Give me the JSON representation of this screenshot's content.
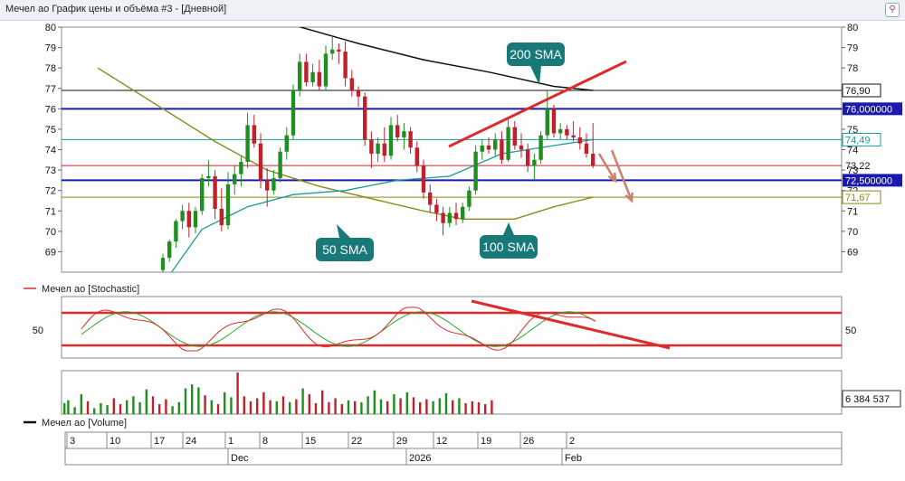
{
  "window": {
    "title": "Мечел ао График цены и объёма #3 - [Дневной]"
  },
  "colors": {
    "up": "#1f8f1f",
    "down": "#c0202a",
    "sma50": "#1a9a9a",
    "sma100": "#8a8a1a",
    "sma200": "#111111",
    "support": "#1a1ab0",
    "trend": "#dd2b2b",
    "arrow": "#c8826a",
    "callout": "#197878"
  },
  "price_panel": {
    "levels": [
      {
        "value": 76.9,
        "label": "76,90",
        "color": "#111111",
        "boxed": true
      },
      {
        "value": 76.0,
        "label": "76,000000",
        "color": "#1a1ab0",
        "highlight": true
      },
      {
        "value": 74.49,
        "label": "74,49",
        "color": "#1a9a9a",
        "boxed": true
      },
      {
        "value": 73.22,
        "label": "73,22",
        "color": "#c0202a",
        "boxed": false
      },
      {
        "value": 72.5,
        "label": "72,500000",
        "color": "#1a1ab0",
        "highlight": true
      },
      {
        "value": 71.67,
        "label": "71,67",
        "color": "#8a8a1a",
        "boxed": true
      }
    ],
    "callouts": [
      "200 SMA",
      "50 SMA",
      "100 SMA"
    ]
  },
  "stochastic_panel": {
    "legend": "Мечел ао [Stochastic]",
    "tick": "50"
  },
  "volume_panel": {
    "legend": "Мечел ао [Volume]",
    "last_value": "6 384 537"
  },
  "time_axis": {
    "day_labels": [
      "3",
      "10",
      "17",
      "24",
      "1",
      "8",
      "15",
      "22",
      "29",
      "12",
      "19",
      "26",
      "2"
    ],
    "month_labels": [
      "Dec",
      "2026",
      "Feb"
    ]
  },
  "chart_data": {
    "type": "candlestick",
    "ylim": [
      68,
      80
    ],
    "yticks": [
      69,
      70,
      71,
      72,
      73,
      74,
      75,
      76,
      77,
      78,
      79,
      80
    ],
    "candles": [
      {
        "o": 68.1,
        "h": 68.9,
        "l": 67.9,
        "c": 68.7
      },
      {
        "o": 68.7,
        "h": 69.6,
        "l": 68.5,
        "c": 69.5
      },
      {
        "o": 69.5,
        "h": 70.6,
        "l": 69.2,
        "c": 70.5
      },
      {
        "o": 70.5,
        "h": 71.3,
        "l": 70.1,
        "c": 71.0
      },
      {
        "o": 71.0,
        "h": 71.4,
        "l": 69.7,
        "c": 70.2
      },
      {
        "o": 70.2,
        "h": 71.2,
        "l": 69.9,
        "c": 71.0
      },
      {
        "o": 71.0,
        "h": 72.8,
        "l": 70.8,
        "c": 72.6
      },
      {
        "o": 72.6,
        "h": 73.5,
        "l": 72.2,
        "c": 72.7
      },
      {
        "o": 72.7,
        "h": 73.0,
        "l": 70.6,
        "c": 71.1
      },
      {
        "o": 71.1,
        "h": 72.1,
        "l": 70.0,
        "c": 70.3
      },
      {
        "o": 70.3,
        "h": 72.9,
        "l": 70.1,
        "c": 72.3
      },
      {
        "o": 72.3,
        "h": 73.2,
        "l": 71.8,
        "c": 72.8
      },
      {
        "o": 72.8,
        "h": 73.7,
        "l": 72.2,
        "c": 73.4
      },
      {
        "o": 73.4,
        "h": 75.8,
        "l": 73.1,
        "c": 75.2
      },
      {
        "o": 75.2,
        "h": 75.7,
        "l": 74.1,
        "c": 74.3
      },
      {
        "o": 74.3,
        "h": 74.8,
        "l": 72.1,
        "c": 72.5
      },
      {
        "o": 72.5,
        "h": 73.1,
        "l": 71.2,
        "c": 72.0
      },
      {
        "o": 72.0,
        "h": 73.0,
        "l": 71.8,
        "c": 72.6
      },
      {
        "o": 72.6,
        "h": 74.1,
        "l": 72.4,
        "c": 73.9
      },
      {
        "o": 73.9,
        "h": 75.1,
        "l": 73.5,
        "c": 74.7
      },
      {
        "o": 74.7,
        "h": 77.2,
        "l": 74.5,
        "c": 76.9
      },
      {
        "o": 76.9,
        "h": 78.7,
        "l": 76.6,
        "c": 78.3
      },
      {
        "o": 78.3,
        "h": 78.7,
        "l": 77.1,
        "c": 77.3
      },
      {
        "o": 77.3,
        "h": 78.2,
        "l": 77.1,
        "c": 77.8
      },
      {
        "o": 77.8,
        "h": 78.4,
        "l": 76.9,
        "c": 77.1
      },
      {
        "o": 77.1,
        "h": 79.1,
        "l": 76.9,
        "c": 78.7
      },
      {
        "o": 78.7,
        "h": 79.6,
        "l": 78.4,
        "c": 78.9
      },
      {
        "o": 78.9,
        "h": 79.2,
        "l": 78.2,
        "c": 78.8
      },
      {
        "o": 78.8,
        "h": 79.3,
        "l": 77.1,
        "c": 77.5
      },
      {
        "o": 77.5,
        "h": 77.9,
        "l": 76.6,
        "c": 76.9
      },
      {
        "o": 76.9,
        "h": 77.1,
        "l": 76.1,
        "c": 76.6
      },
      {
        "o": 76.6,
        "h": 76.8,
        "l": 74.2,
        "c": 74.5
      },
      {
        "o": 74.5,
        "h": 74.9,
        "l": 73.1,
        "c": 73.8
      },
      {
        "o": 73.8,
        "h": 74.6,
        "l": 73.4,
        "c": 74.3
      },
      {
        "o": 74.3,
        "h": 75.1,
        "l": 73.4,
        "c": 73.7
      },
      {
        "o": 73.7,
        "h": 75.6,
        "l": 73.5,
        "c": 75.2
      },
      {
        "o": 75.2,
        "h": 75.7,
        "l": 74.4,
        "c": 74.6
      },
      {
        "o": 74.6,
        "h": 75.3,
        "l": 74.0,
        "c": 74.9
      },
      {
        "o": 74.9,
        "h": 75.1,
        "l": 73.8,
        "c": 74.1
      },
      {
        "o": 74.1,
        "h": 74.4,
        "l": 72.9,
        "c": 73.2
      },
      {
        "o": 73.2,
        "h": 73.5,
        "l": 71.6,
        "c": 71.9
      },
      {
        "o": 71.9,
        "h": 72.3,
        "l": 70.9,
        "c": 71.3
      },
      {
        "o": 71.3,
        "h": 71.6,
        "l": 70.5,
        "c": 70.9
      },
      {
        "o": 70.9,
        "h": 71.2,
        "l": 69.8,
        "c": 70.4
      },
      {
        "o": 70.4,
        "h": 71.2,
        "l": 70.2,
        "c": 70.9
      },
      {
        "o": 70.9,
        "h": 71.4,
        "l": 70.3,
        "c": 70.6
      },
      {
        "o": 70.6,
        "h": 71.4,
        "l": 70.4,
        "c": 71.2
      },
      {
        "o": 71.2,
        "h": 72.2,
        "l": 71.0,
        "c": 72.0
      },
      {
        "o": 72.0,
        "h": 74.2,
        "l": 71.8,
        "c": 73.9
      },
      {
        "o": 73.9,
        "h": 74.5,
        "l": 73.5,
        "c": 74.2
      },
      {
        "o": 74.2,
        "h": 74.6,
        "l": 73.8,
        "c": 74.0
      },
      {
        "o": 74.0,
        "h": 74.8,
        "l": 73.7,
        "c": 74.5
      },
      {
        "o": 74.5,
        "h": 74.9,
        "l": 73.3,
        "c": 73.5
      },
      {
        "o": 73.5,
        "h": 75.5,
        "l": 73.4,
        "c": 75.1
      },
      {
        "o": 75.1,
        "h": 75.4,
        "l": 74.0,
        "c": 74.2
      },
      {
        "o": 74.2,
        "h": 74.8,
        "l": 73.6,
        "c": 74.0
      },
      {
        "o": 74.0,
        "h": 74.3,
        "l": 72.9,
        "c": 73.2
      },
      {
        "o": 73.2,
        "h": 73.8,
        "l": 72.5,
        "c": 73.5
      },
      {
        "o": 73.5,
        "h": 74.9,
        "l": 73.3,
        "c": 74.7
      },
      {
        "o": 74.7,
        "h": 76.9,
        "l": 74.5,
        "c": 76.0
      },
      {
        "o": 76.0,
        "h": 76.2,
        "l": 74.6,
        "c": 74.8
      },
      {
        "o": 74.8,
        "h": 75.3,
        "l": 74.5,
        "c": 75.0
      },
      {
        "o": 75.0,
        "h": 75.2,
        "l": 74.5,
        "c": 74.7
      },
      {
        "o": 74.7,
        "h": 75.4,
        "l": 74.4,
        "c": 74.6
      },
      {
        "o": 74.6,
        "h": 75.1,
        "l": 74.0,
        "c": 74.3
      },
      {
        "o": 74.3,
        "h": 74.8,
        "l": 73.6,
        "c": 73.8
      },
      {
        "o": 73.8,
        "h": 75.3,
        "l": 73.1,
        "c": 73.22
      }
    ],
    "sma50": [
      [
        0,
        67.4
      ],
      [
        6,
        70.1
      ],
      [
        13,
        71.2
      ],
      [
        20,
        71.8
      ],
      [
        28,
        72.0
      ],
      [
        36,
        72.5
      ],
      [
        44,
        72.7
      ],
      [
        52,
        73.8
      ],
      [
        60,
        74.2
      ],
      [
        66,
        74.49
      ]
    ],
    "sma100": [
      [
        -10,
        78.0
      ],
      [
        0,
        76.0
      ],
      [
        8,
        74.4
      ],
      [
        16,
        73.0
      ],
      [
        24,
        72.2
      ],
      [
        32,
        71.6
      ],
      [
        40,
        71.0
      ],
      [
        46,
        70.6
      ],
      [
        54,
        70.6
      ],
      [
        60,
        71.2
      ],
      [
        66,
        71.67
      ]
    ],
    "sma200": [
      [
        20,
        80.1
      ],
      [
        30,
        79.2
      ],
      [
        40,
        78.4
      ],
      [
        50,
        77.8
      ],
      [
        60,
        77.1
      ],
      [
        66,
        76.9
      ]
    ],
    "volume": [
      1.1,
      1.4,
      0.7,
      2.0,
      1.3,
      0.6,
      1.1,
      0.9,
      1.6,
      1.0,
      1.4,
      1.8,
      1.2,
      2.5,
      1.8,
      1.0,
      1.5,
      0.8,
      1.2,
      2.6,
      3.0,
      2.7,
      1.9,
      1.4,
      1.0,
      2.2,
      1.7,
      4.2,
      1.8,
      1.3,
      1.6,
      2.2,
      1.4,
      1.3,
      1.8,
      1.2,
      1.5,
      2.6,
      2.0,
      1.1,
      2.4,
      1.2,
      1.6,
      1.0,
      1.4,
      1.3,
      1.2,
      1.8,
      2.4,
      1.5,
      1.3,
      2.0,
      1.6,
      2.2,
      1.7,
      1.2,
      1.5,
      1.3,
      1.6,
      2.1,
      1.4,
      1.6,
      1.1,
      1.3,
      1.2,
      1.0,
      1.4
    ]
  }
}
